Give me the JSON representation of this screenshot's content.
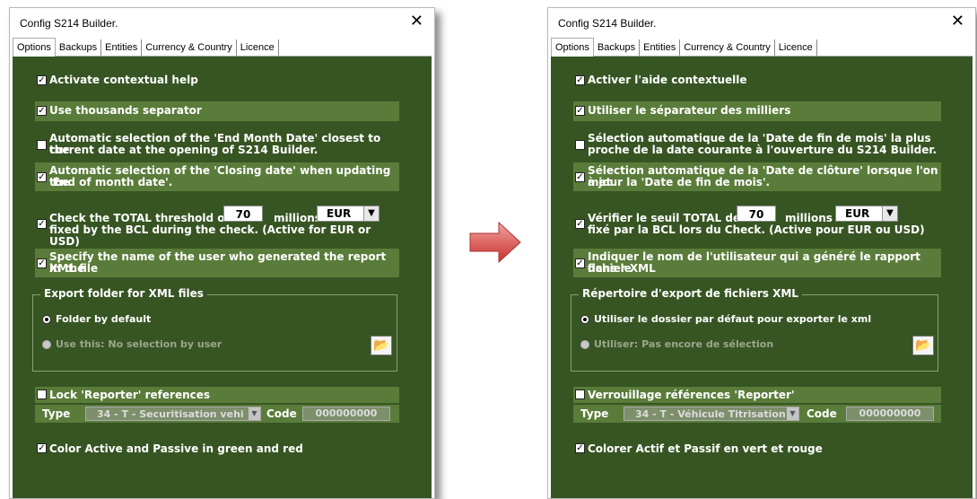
{
  "colors": {
    "panel": "#375523",
    "highlight": "#5a7c3a",
    "arrow": "#d9534f"
  },
  "left": {
    "title": "Config S214 Builder.",
    "close": "✕",
    "tabs": [
      "Options",
      "Backups",
      "Entities",
      "Currency & Country",
      "Licence"
    ],
    "opt1": "Activate contextual help",
    "opt2": "Use thousands separator",
    "opt3a": "Automatic selection of the 'End Month Date' closest to the",
    "opt3b": "current date at the opening of S214 Builder.",
    "opt4a": "Automatic selection of the 'Closing date' when updating the",
    "opt4b": "'End of month date'.",
    "opt5a": "Check the TOTAL threshold of",
    "threshold": "70",
    "millions": "millions",
    "currency": "EUR",
    "opt5b": "fixed by the BCL during the check. (Active for EUR or USD)",
    "opt6a": "Specify the name of the user who generated the report in the",
    "opt6b": "XML file",
    "group_title": "Export folder for XML files",
    "radio1": "Folder by default",
    "radio2": "Use this: No selection by user",
    "lock": "Lock 'Reporter' references",
    "type_label": "Type",
    "type_value": "34 - T - Securitisation vehi",
    "code_label": "Code",
    "code_value": "000000000",
    "color_opt": "Color Active and Passive in green and red"
  },
  "right": {
    "title": "Config S214 Builder.",
    "close": "✕",
    "tabs": [
      "Options",
      "Backups",
      "Entities",
      "Currency & Country",
      "Licence"
    ],
    "opt1": "Activer l'aide contextuelle",
    "opt2": "Utiliser le séparateur des milliers",
    "opt3a": "Sélection automatique de la  'Date de fin de mois'  la plus",
    "opt3b": "proche de la date courante à l'ouverture du S214 Builder.",
    "opt4a": "Sélection automatique de la 'Date de clôture' lorsque l'on met",
    "opt4b": "à jour la 'Date de fin de mois'.",
    "opt5a": "Vérifier le seuil TOTAL de",
    "threshold": "70",
    "millions": "millions",
    "currency": "EUR",
    "opt5b": "fixé par la BCL lors du Check. (Active pour EUR ou USD)",
    "opt6a": "Indiquer le nom de l'utilisateur qui a généré le rapport dans le",
    "opt6b": "fichier XML",
    "group_title": "Répertoire d'export de fichiers XML",
    "radio1": "Utiliser le dossier par défaut pour exporter le xml",
    "radio2": "Utiliser: Pas encore de sélection",
    "lock": "Verrouillage références 'Reporter'",
    "type_label": "Type",
    "type_value": "34 - T - Véhicule Titrisation",
    "code_label": "Code",
    "code_value": "000000000",
    "color_opt": "Colorer Actif et Passif en vert et rouge"
  }
}
